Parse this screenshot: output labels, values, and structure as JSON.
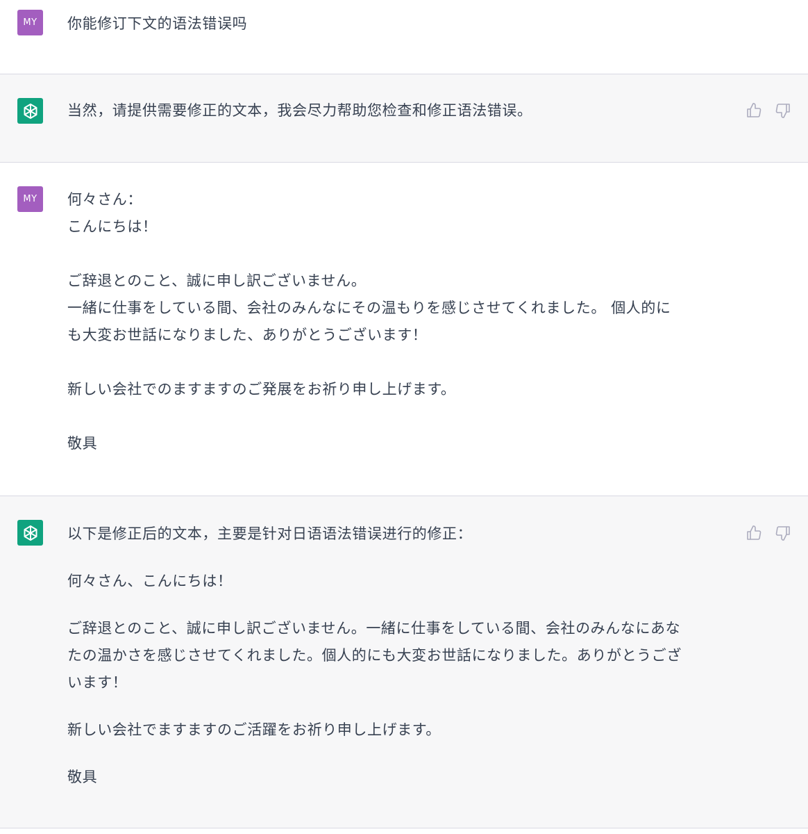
{
  "user_avatar_label": "MY",
  "icons": {
    "assistant_avatar": "openai-logo-icon",
    "thumbs_up": "thumbs-up-icon",
    "thumbs_down": "thumbs-down-icon"
  },
  "colors": {
    "user_avatar_bg": "#a35ebf",
    "assistant_avatar_bg": "#10a37f",
    "assistant_row_bg": "#f7f7f8"
  },
  "messages": [
    {
      "role": "user",
      "lines": [
        "你能修订下文的语法错误吗"
      ]
    },
    {
      "role": "assistant",
      "lines": [
        "当然，请提供需要修正的文本，我会尽力帮助您检查和修正语法错误。"
      ]
    },
    {
      "role": "user",
      "lines": [
        "何々さん：",
        "こんにちは！",
        "",
        "ご辞退とのこと、誠に申し訳ございません。",
        "一緒に仕事をしている間、会社のみんなにその温もりを感じさせてくれました。 個人的に",
        "も大変お世話になりました、ありがとうございます！",
        "",
        "新しい会社でのますますのご発展をお祈り申し上げます。",
        "",
        "敬具"
      ]
    },
    {
      "role": "assistant",
      "lines": [
        "以下是修正后的文本，主要是针对日语语法错误进行的修正：",
        "何々さん、こんにちは！",
        "ご辞退とのこと、誠に申し訳ございません。一緒に仕事をしている間、会社のみんなにあな",
        "たの温かさを感じさせてくれました。個人的にも大変お世話になりました。ありがとうござ",
        "います！",
        "新しい会社でますますのご活躍をお祈り申し上げます。",
        "敬具"
      ]
    }
  ]
}
